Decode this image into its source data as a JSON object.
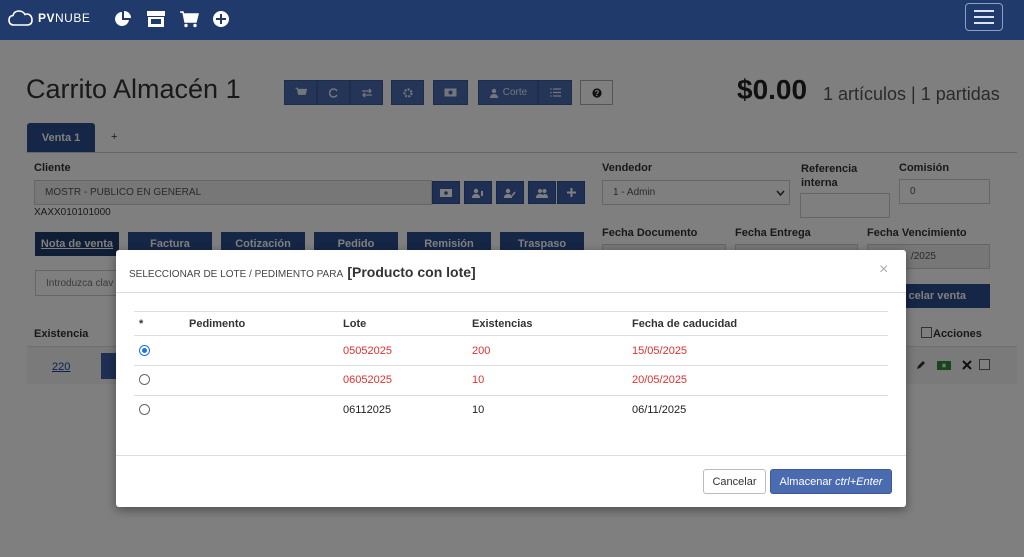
{
  "brand": {
    "name_bold": "PV",
    "name_light": "NUBE"
  },
  "nav_icons": [
    "pie-chart-icon",
    "store-icon",
    "cart-icon",
    "plus-circle-icon"
  ],
  "page": {
    "title": "Carrito Almacén 1",
    "corte_label": "Corte",
    "total": "$0.00",
    "summary": "1 artículos | 1 partidas"
  },
  "tabs": [
    {
      "label": "Venta 1"
    },
    {
      "label": "+"
    }
  ],
  "cliente": {
    "label": "Cliente",
    "value": "MOSTR - PUBLICO EN GENERAL",
    "rfc": "XAXX010101000"
  },
  "vendedor": {
    "label": "Vendedor",
    "value": "1 - Admin"
  },
  "referencia": {
    "label": "Referencia interna",
    "value": ""
  },
  "comision": {
    "label": "Comisión",
    "value": "0"
  },
  "fechas": {
    "documento_label": "Fecha Documento",
    "entrega_label": "Fecha Entrega",
    "vencimiento_label": "Fecha Vencimiento",
    "vencimiento_value_partial": "/2025"
  },
  "doc_types": [
    "Nota de venta",
    "Factura",
    "Cotización",
    "Pedido",
    "Remisión",
    "Traspaso"
  ],
  "search": {
    "placeholder": "Introduzca clav"
  },
  "cancel_sale_partial": "celar venta",
  "table_bg": {
    "existencia_header": "Existencia",
    "acciones_header": "Acciones",
    "existencia_value": "220"
  },
  "modal": {
    "title_prefix": "SELECCIONAR DE LOTE / PEDIMENTO PARA",
    "product": "[Producto con lote]",
    "close_label": "×",
    "columns": [
      "*",
      "Pedimento",
      "Lote",
      "Existencias",
      "Fecha de caducidad"
    ],
    "rows": [
      {
        "selected": true,
        "pedimento": "",
        "lote": "05052025",
        "existencias": "200",
        "caducidad": "15/05/2025",
        "status_color": "#e03030"
      },
      {
        "selected": false,
        "pedimento": "",
        "lote": "06052025",
        "existencias": "10",
        "caducidad": "20/05/2025",
        "status_color": "#e03030"
      },
      {
        "selected": false,
        "pedimento": "",
        "lote": "06112025",
        "existencias": "10",
        "caducidad": "06/11/2025",
        "status_color": "#222222"
      }
    ],
    "cancel_label": "Cancelar",
    "save_label": "Almacenar",
    "save_shortcut": "ctrl+Enter"
  },
  "colors": {
    "navbar": "#1f3a6b",
    "primary": "#4a6bb0",
    "expired": "#e03030"
  }
}
